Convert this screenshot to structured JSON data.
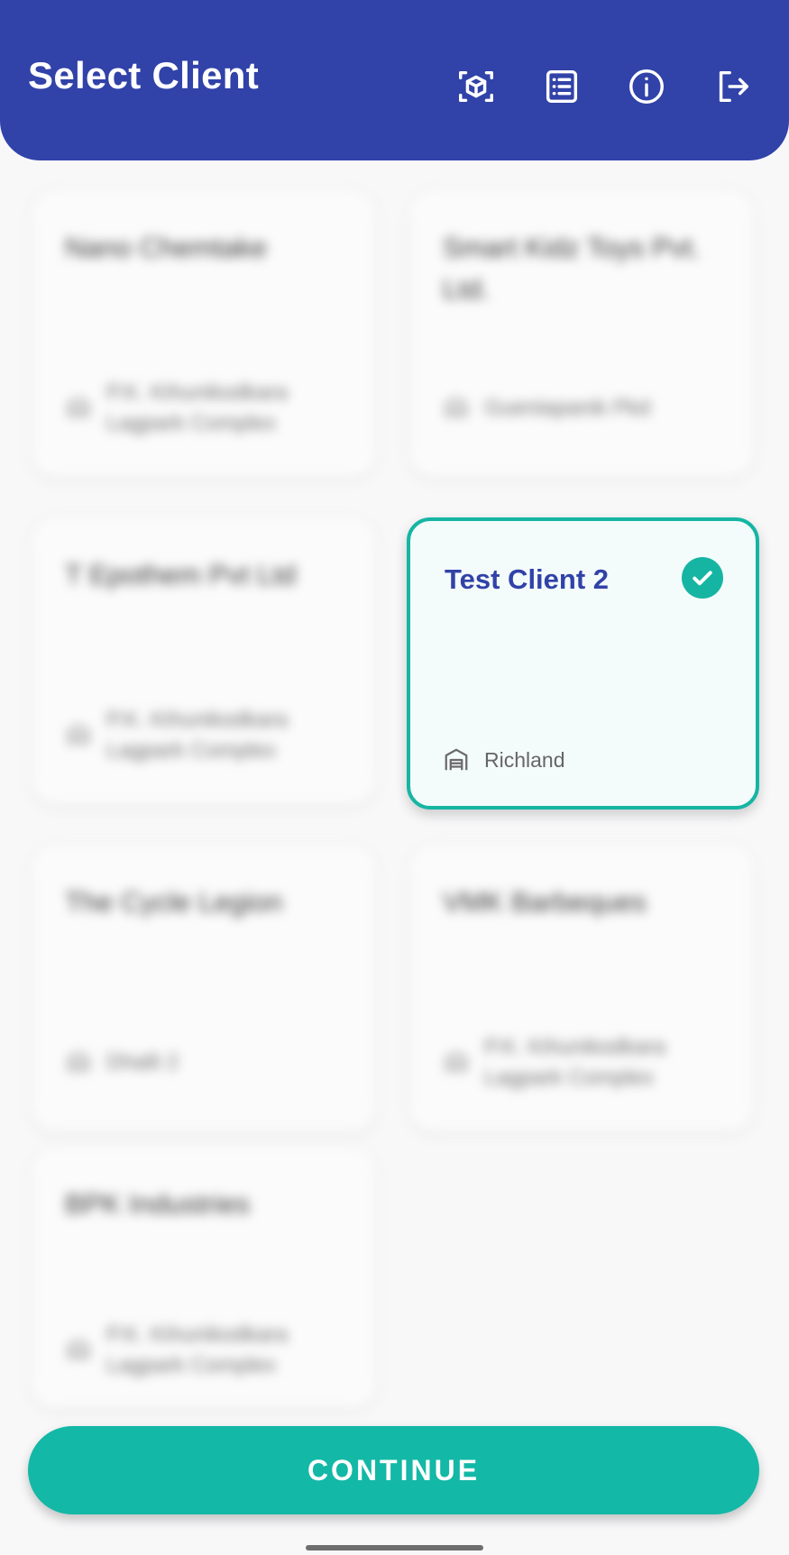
{
  "header": {
    "title": "Select Client",
    "bg_color": "#3142a8",
    "icons": [
      "scan-cube-icon",
      "list-icon",
      "info-icon",
      "logout-icon"
    ]
  },
  "clients": [
    {
      "name": "Nano Chemtake",
      "location": "P.K. Kihunikodkara Lagpark Complex",
      "selected": false
    },
    {
      "name": "Smart Kidz Toys Pvt. Ltd.",
      "location": "Guentapanik Pkd",
      "selected": false
    },
    {
      "name": "T Epothem Pvt Ltd",
      "location": "P.K. Kihunikodkara Lagpark Complex",
      "selected": false
    },
    {
      "name": "Test Client 2",
      "location": "Richland",
      "selected": true
    },
    {
      "name": "The Cycle Legion",
      "location": "Dhalli 2",
      "selected": false
    },
    {
      "name": "VMK Barbeques",
      "location": "P.K. Kihunikodkara Lagpark Complex",
      "selected": false
    },
    {
      "name": "BPK Industries",
      "location": "P.K. Kihunikodkara Lagpark Complex",
      "selected": false
    }
  ],
  "continue_label": "CONTINUE",
  "accent_color": "#16b5a3"
}
